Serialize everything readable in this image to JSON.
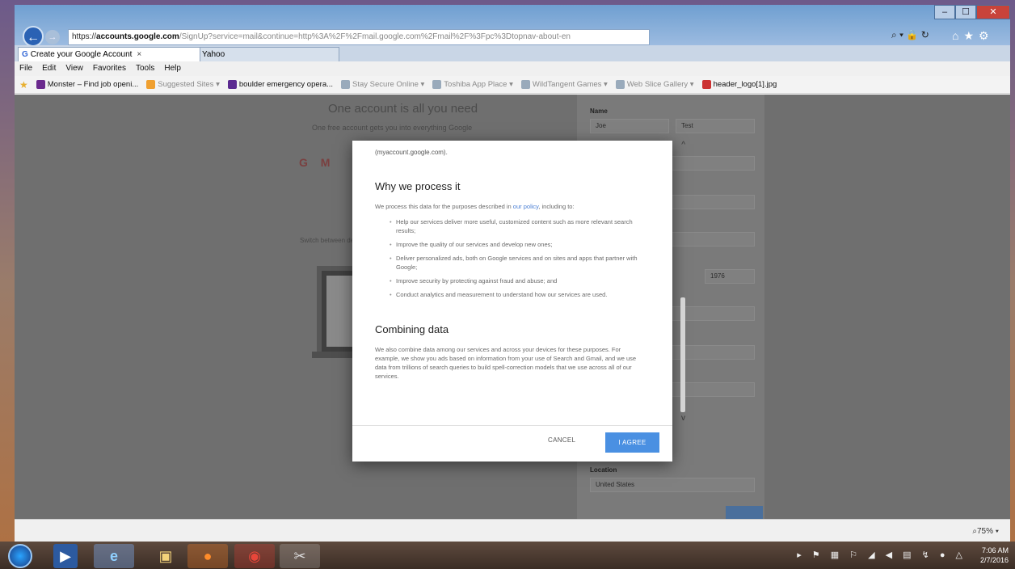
{
  "browser": {
    "address": {
      "scheme": "https://",
      "domain": "accounts.google.com",
      "rest": "/SignUp?service=mail&continue=http%3A%2F%2Fmail.google.com%2Fmail%2F%3Fpc%3Dtopnav-about-en"
    },
    "window_controls": [
      "–",
      "☐",
      "✕"
    ],
    "tabs": [
      {
        "icon": "G",
        "label": "Create your Google Account",
        "active": true
      },
      {
        "icon": "Y",
        "label": "Yahoo",
        "active": false
      }
    ],
    "menu": [
      "File",
      "Edit",
      "View",
      "Favorites",
      "Tools",
      "Help"
    ],
    "favorites": [
      {
        "label": "Monster – Find job openi...",
        "color": "#6b2a8e"
      },
      {
        "label": "Suggested Sites ▾",
        "color": "#f0a030"
      },
      {
        "label": "boulder emergency opera...",
        "color": "#5b2a91"
      },
      {
        "label": "Stay Secure Online ▾",
        "color": "#9ab"
      },
      {
        "label": "Toshiba App Place ▾",
        "color": "#9ab"
      },
      {
        "label": "WildTangent Games ▾",
        "color": "#9ab"
      },
      {
        "label": "Web Slice Gallery ▾",
        "color": "#9ab"
      },
      {
        "label": "header_logo[1].jpg",
        "color": "#c33"
      }
    ],
    "zoom": "75%"
  },
  "background_page": {
    "heading": "One account is all you need",
    "sub": "One free account gets you into everything Google",
    "small": "Switch between devices...",
    "form": {
      "name_label": "Name",
      "first": "Joe",
      "last": "Test",
      "location_label": "Location",
      "location_value": "United States",
      "year": "1976"
    }
  },
  "modal": {
    "top_text": "(myaccount.google.com).",
    "why_heading": "Why we process it",
    "why_intro_pre": "We process this data for the purposes described in ",
    "why_intro_link": "our policy",
    "why_intro_post": ", including to:",
    "bullets": [
      "Help our services deliver more useful, customized content such as more relevant search results;",
      "Improve the quality of our services and develop new ones;",
      "Deliver personalized ads, both on Google services and on sites and apps that partner with Google;",
      "Improve security by protecting against fraud and abuse; and",
      "Conduct analytics and measurement to understand how our services are used."
    ],
    "combining_heading": "Combining data",
    "combining_text": "We also combine data among our services and across your devices for these purposes. For example, we show you ads based on information from your use of Search and Gmail, and we use data from trillions of search queries to build spell-correction models that we use across all of our services.",
    "cancel": "CANCEL",
    "agree": "I AGREE"
  },
  "taskbar": {
    "time": "7:06 AM",
    "date": "2/7/2016"
  }
}
